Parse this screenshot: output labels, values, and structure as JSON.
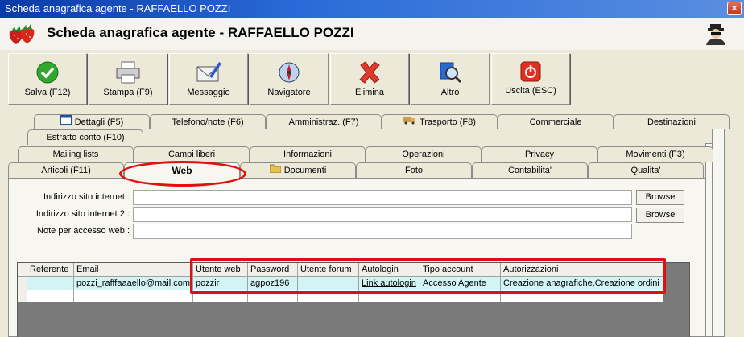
{
  "window": {
    "title": "Scheda anagrafica agente - RAFFAELLO POZZI"
  },
  "header": {
    "title": "Scheda anagrafica agente - RAFFAELLO POZZI"
  },
  "toolbar": [
    {
      "label": "Salva (F12)",
      "icon": "check-icon"
    },
    {
      "label": "Stampa (F9)",
      "icon": "printer-icon"
    },
    {
      "label": "Messaggio",
      "icon": "envelope-pen-icon"
    },
    {
      "label": "Navigatore",
      "icon": "compass-icon"
    },
    {
      "label": "Elimina",
      "icon": "delete-x-icon"
    },
    {
      "label": "Altro",
      "icon": "magnifier-icon"
    },
    {
      "label": "Uscita (ESC)",
      "icon": "exit-icon"
    }
  ],
  "tabs_row1": [
    "Dettagli (F5)",
    "Telefono/note (F6)",
    "Amministraz. (F7)",
    "Trasporto (F8)",
    "Commerciale",
    "Destinazioni"
  ],
  "tabs_row1b": [
    "Estratto conto (F10)"
  ],
  "tabs_row2": [
    "Mailing lists",
    "Campi liberi",
    "Informazioni",
    "Operazioni",
    "Privacy",
    "Movimenti (F3)"
  ],
  "tabs_row3": [
    "Articoli (F11)",
    "Web",
    "Documenti",
    "Foto",
    "Contabilita'",
    "Qualita'"
  ],
  "form": {
    "site_label": "Indirizzo sito internet :",
    "site_value": "",
    "site2_label": "Indirizzo sito internet 2 :",
    "site2_value": "",
    "notes_label": "Note per accesso web :",
    "notes_value": "",
    "browse_label": "Browse"
  },
  "grid": {
    "columns": [
      "Referente",
      "Email",
      "Utente web",
      "Password",
      "Utente forum",
      "Autologin",
      "Tipo account",
      "Autorizzazioni"
    ],
    "rows": [
      [
        "",
        "pozzi_rafffaaaello@mail.com",
        "pozzir",
        "agpoz196",
        "",
        "Link autologin",
        "Accesso Agente",
        "Creazione anagrafiche,Creazione ordini"
      ]
    ]
  },
  "colors": {
    "title_bar": "#0a3aa8",
    "highlight": "#e01010",
    "row_selected": "#d2f4f4"
  }
}
